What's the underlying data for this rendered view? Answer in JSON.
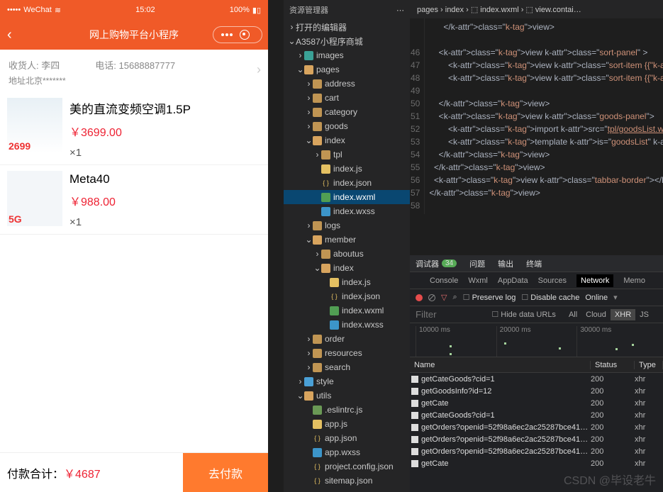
{
  "phone": {
    "carrier": "WeChat",
    "time": "15:02",
    "battery": "100%",
    "title": "网上购物平台小程序",
    "address": {
      "receiver_label": "收货人:",
      "receiver": "李四",
      "phone_label": "电话:",
      "phone": "15688887777",
      "addr_line": "地址北京*******"
    },
    "goods": [
      {
        "img_label": "2699",
        "title": "美的直流变频空调1.5P",
        "price": "￥3699.00",
        "qty": "×1",
        "style": "ac"
      },
      {
        "img_label": "5G",
        "title": "Meta40",
        "price": "￥988.00",
        "qty": "×1",
        "style": "phoneimg"
      }
    ],
    "total_label": "付款合计：",
    "total_value": "￥4687",
    "pay_btn": "去付款"
  },
  "explorer": {
    "title": "资源管理器",
    "section1": "打开的编辑器",
    "section2": "A3587小程序商城",
    "tree": [
      {
        "d": 1,
        "t": "c",
        "ic": "folder-img",
        "l": "images"
      },
      {
        "d": 1,
        "t": "o",
        "ic": "folder-open",
        "l": "pages"
      },
      {
        "d": 2,
        "t": "c",
        "ic": "folder",
        "l": "address"
      },
      {
        "d": 2,
        "t": "c",
        "ic": "folder",
        "l": "cart"
      },
      {
        "d": 2,
        "t": "c",
        "ic": "folder",
        "l": "category"
      },
      {
        "d": 2,
        "t": "c",
        "ic": "folder",
        "l": "goods"
      },
      {
        "d": 2,
        "t": "o",
        "ic": "folder-open",
        "l": "index"
      },
      {
        "d": 3,
        "t": "c",
        "ic": "folder",
        "l": "tpl"
      },
      {
        "d": 3,
        "t": "f",
        "ic": "js",
        "l": "index.js"
      },
      {
        "d": 3,
        "t": "f",
        "ic": "json",
        "l": "index.json"
      },
      {
        "d": 3,
        "t": "f",
        "ic": "wxml",
        "l": "index.wxml",
        "sel": true
      },
      {
        "d": 3,
        "t": "f",
        "ic": "wxss",
        "l": "index.wxss"
      },
      {
        "d": 2,
        "t": "c",
        "ic": "folder",
        "l": "logs"
      },
      {
        "d": 2,
        "t": "o",
        "ic": "folder-open",
        "l": "member"
      },
      {
        "d": 3,
        "t": "c",
        "ic": "folder",
        "l": "aboutus"
      },
      {
        "d": 3,
        "t": "o",
        "ic": "folder-open",
        "l": "index"
      },
      {
        "d": 4,
        "t": "f",
        "ic": "js",
        "l": "index.js"
      },
      {
        "d": 4,
        "t": "f",
        "ic": "json",
        "l": "index.json"
      },
      {
        "d": 4,
        "t": "f",
        "ic": "wxml",
        "l": "index.wxml"
      },
      {
        "d": 4,
        "t": "f",
        "ic": "wxss",
        "l": "index.wxss"
      },
      {
        "d": 2,
        "t": "c",
        "ic": "folder",
        "l": "order"
      },
      {
        "d": 2,
        "t": "c",
        "ic": "folder",
        "l": "resources"
      },
      {
        "d": 2,
        "t": "c",
        "ic": "folder",
        "l": "search"
      },
      {
        "d": 1,
        "t": "c",
        "ic": "folder-blue",
        "l": "style"
      },
      {
        "d": 1,
        "t": "o",
        "ic": "folder-open",
        "l": "utils"
      },
      {
        "d": 2,
        "t": "f",
        "ic": "misc",
        "l": ".eslintrc.js"
      },
      {
        "d": 2,
        "t": "f",
        "ic": "js",
        "l": "app.js"
      },
      {
        "d": 2,
        "t": "f",
        "ic": "json",
        "l": "app.json"
      },
      {
        "d": 2,
        "t": "f",
        "ic": "wxss",
        "l": "app.wxss"
      },
      {
        "d": 2,
        "t": "f",
        "ic": "json",
        "l": "project.config.json"
      },
      {
        "d": 2,
        "t": "f",
        "ic": "json",
        "l": "sitemap.json"
      }
    ]
  },
  "editor": {
    "breadcrumbs": "pages › index › ⬚ index.wxml › ⬚ view.contai…",
    "gutter": [
      "",
      "",
      "46",
      "47",
      "48",
      "49",
      "50",
      "51",
      "52",
      "53",
      "54",
      "55",
      "56",
      "57",
      "58"
    ],
    "lines": [
      "      </view>",
      "",
      "    <view class=\"sort-panel\" >",
      "        <view class=\"sort-item {{order=='rand'?'on'",
      "        <view class=\"sort-item {{order=='desc'?'on'",
      "",
      "    </view>",
      "    <view class=\"goods-panel\">",
      "        <import src=\"tpl/goodsList.wxml\"/>",
      "        <template is=\"goodsList\" data=\"{{goodsList:",
      "    </view>",
      "  </view>",
      "  <view class=\"tabbar-border\"></view>",
      "</view>",
      ""
    ]
  },
  "devtools": {
    "top": {
      "tab1": "调试器",
      "badge": "34",
      "tab2": "问题",
      "tab3": "输出",
      "tab4": "终端"
    },
    "tabs": [
      "Console",
      "Wxml",
      "AppData",
      "Sources",
      "Network",
      "Memo"
    ],
    "active_tab": "Network",
    "toolbar": {
      "preserve": "Preserve log",
      "disable": "Disable cache",
      "online": "Online"
    },
    "filter": {
      "ph": "Filter",
      "hide": "Hide data URLs",
      "seg": [
        "All",
        "Cloud",
        "XHR",
        "JS"
      ],
      "seg_active": "XHR"
    },
    "timeline": [
      "10000 ms",
      "20000 ms",
      "30000 ms"
    ],
    "columns": {
      "name": "Name",
      "status": "Status",
      "type": "Type"
    },
    "rows": [
      {
        "n": "getCateGoods?cid=1",
        "s": "200",
        "t": "xhr"
      },
      {
        "n": "getGoodsInfo?id=12",
        "s": "200",
        "t": "xhr"
      },
      {
        "n": "getCate",
        "s": "200",
        "t": "xhr"
      },
      {
        "n": "getCateGoods?cid=1",
        "s": "200",
        "t": "xhr"
      },
      {
        "n": "getOrders?openid=52f98a6ec2ac25287bce4139…",
        "s": "200",
        "t": "xhr"
      },
      {
        "n": "getOrders?openid=52f98a6ec2ac25287bce4139…",
        "s": "200",
        "t": "xhr"
      },
      {
        "n": "getOrders?openid=52f98a6ec2ac25287bce4139…",
        "s": "200",
        "t": "xhr"
      },
      {
        "n": "getCate",
        "s": "200",
        "t": "xhr"
      }
    ]
  },
  "watermark": "CSDN @毕设老牛"
}
